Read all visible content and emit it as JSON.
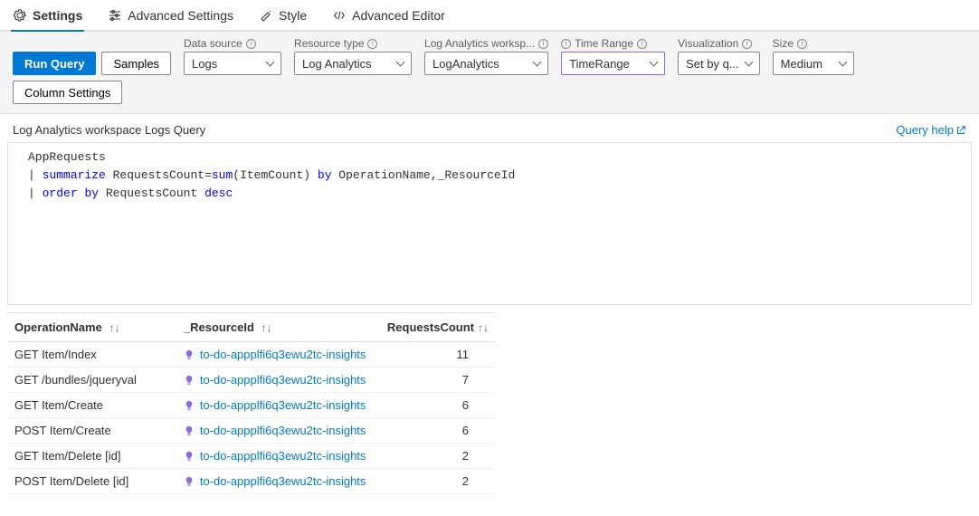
{
  "tabs": [
    {
      "label": "Settings",
      "icon": "gear-icon",
      "active": true
    },
    {
      "label": "Advanced Settings",
      "icon": "sliders-icon",
      "active": false
    },
    {
      "label": "Style",
      "icon": "brush-icon",
      "active": false
    },
    {
      "label": "Advanced Editor",
      "icon": "code-icon",
      "active": false
    }
  ],
  "buttons": {
    "run_query": "Run Query",
    "samples": "Samples",
    "column_settings": "Column Settings"
  },
  "fields": {
    "data_source": {
      "label": "Data source",
      "value": "Logs"
    },
    "resource_type": {
      "label": "Resource type",
      "value": "Log Analytics"
    },
    "la_workspace": {
      "label": "Log Analytics worksp...",
      "value": "LogAnalytics"
    },
    "time_range": {
      "label": "Time Range",
      "value": "TimeRange"
    },
    "visualization": {
      "label": "Visualization",
      "value": "Set by q..."
    },
    "size": {
      "label": "Size",
      "value": "Medium"
    }
  },
  "subtitle": "Log Analytics workspace Logs Query",
  "help_link": "Query help",
  "query": {
    "line1_plain": "AppRequests",
    "line2_pipe": "| ",
    "line2_kw1": "summarize",
    "line2_mid": " RequestsCount=",
    "line2_fn": "sum",
    "line2_mid2": "(ItemCount) ",
    "line2_kw2": "by",
    "line2_tail": " OperationName,_ResourceId",
    "line3_pipe": "| ",
    "line3_kw1": "order",
    "line3_sp": " ",
    "line3_kw2": "by",
    "line3_mid": " RequestsCount ",
    "line3_kw3": "desc"
  },
  "table": {
    "columns": {
      "operation": "OperationName",
      "resource": "_ResourceId",
      "count": "RequestsCount"
    },
    "sort_glyph": "↑↓",
    "rows": [
      {
        "op": "GET Item/Index",
        "res": "to-do-appplfi6q3ewu2tc-insights",
        "cnt": "11"
      },
      {
        "op": "GET /bundles/jqueryval",
        "res": "to-do-appplfi6q3ewu2tc-insights",
        "cnt": "7"
      },
      {
        "op": "GET Item/Create",
        "res": "to-do-appplfi6q3ewu2tc-insights",
        "cnt": "6"
      },
      {
        "op": "POST Item/Create",
        "res": "to-do-appplfi6q3ewu2tc-insights",
        "cnt": "6"
      },
      {
        "op": "GET Item/Delete [id]",
        "res": "to-do-appplfi6q3ewu2tc-insights",
        "cnt": "2"
      },
      {
        "op": "POST Item/Delete [id]",
        "res": "to-do-appplfi6q3ewu2tc-insights",
        "cnt": "2"
      }
    ]
  }
}
